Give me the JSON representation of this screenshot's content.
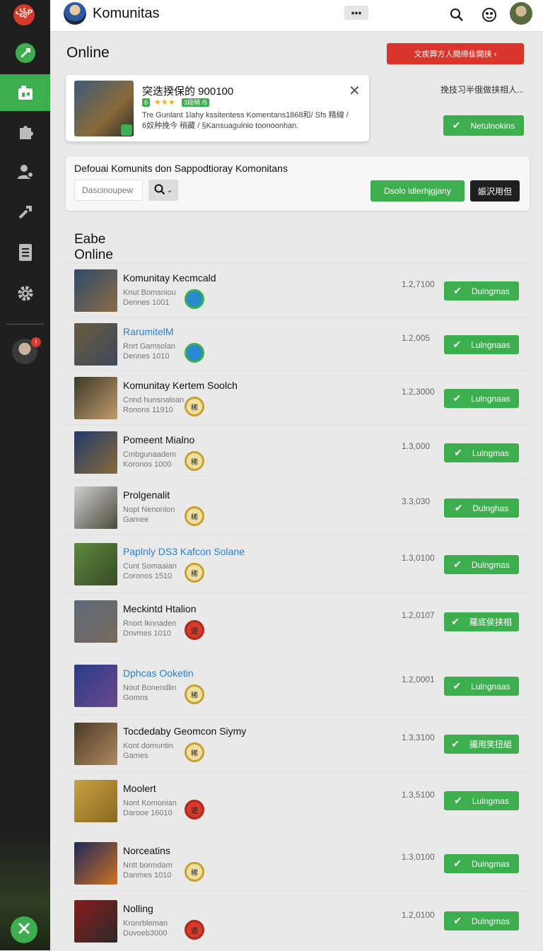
{
  "sidebar": {
    "logo_text": "꧁P",
    "items": [
      {
        "icon": "rocket-icon",
        "active": false
      },
      {
        "icon": "building-icon",
        "active": true
      },
      {
        "icon": "puzzle-icon",
        "active": false
      },
      {
        "icon": "user-settings-icon",
        "active": false
      },
      {
        "icon": "wrench-icon",
        "active": false
      },
      {
        "icon": "document-icon",
        "active": false
      },
      {
        "icon": "gear-icon",
        "active": false
      }
    ],
    "notif_count": "!"
  },
  "topbar": {
    "title": "Komunitas",
    "more_label": "•••"
  },
  "header": {
    "title": "Online",
    "red_button": "文疾葬方人閱缔隹開挟 ›"
  },
  "featured": {
    "title": "突迭揆保的 900100",
    "tag1": "6",
    "tag2": "3段稍 /5",
    "desc": "Tre Gunlant  1lahy kssitentess Komentans1868和/ Sfs 精線 / 6奴种挽今 稍藏 / §Kansuagulnio toonoonhan.",
    "side_text": "挽技习半俄做挟相人...",
    "notify_label": "Netulnokins"
  },
  "search": {
    "label": "Defouai Komunits don Sappodtioray Komonitans",
    "placeholder": "Dascinoupew",
    "discover_label": "Dsolo ldlerhjgjany",
    "dark_label": "娠沢用但"
  },
  "list": {
    "title": "Eabe Online",
    "groups": [
      [
        {
          "name": "Komunitay Kecmcald",
          "sub1": "Knut Bomsniou",
          "sub2": "Dennes 1001",
          "badge": "",
          "count": "1.2,7100",
          "btn": "Dulngmas"
        },
        {
          "name": "RarumitelM",
          "sub1": "Rnrt Gamsolan",
          "sub2": "Dennes 1010",
          "badge": "",
          "count": "1.2,005",
          "btn": "Lulngnaas"
        },
        {
          "name": "Komunitay Kertem Soolch",
          "sub1": "Cnnd hunsnaloan",
          "sub2": "Ronons 11910",
          "badge": "稀",
          "count": "1.2,3000",
          "btn": "Lulngnaas"
        },
        {
          "name": "Pomeent Mialno",
          "sub1": "Cmbgunaadem",
          "sub2": "Koronos 1000",
          "badge": "稀",
          "count": "1.3,000",
          "btn": "Lulngmas"
        },
        {
          "name": "Prolgenalit",
          "sub1": "Nopt Nenonlon",
          "sub2": "Gamee",
          "badge": "稀",
          "count": "3.3,030",
          "btn": "Dulnghas"
        },
        {
          "name": "Paplnly  DS3  Kafcon Solane",
          "sub1": "Cunt Somaaian",
          "sub2": "Coronos 1510",
          "badge": "稀",
          "count": "1.3,0100",
          "btn": "Dulngmas"
        },
        {
          "name": "Meckintd Htalion",
          "sub1": "Rnort Iknnaden",
          "sub2": "Dnvmes 1010",
          "badge": "遊",
          "count": "1.2,0107",
          "btn": "羅底侯挟相"
        }
      ],
      [
        {
          "name": "Dphcas Ooketin",
          "sub1": "Nout Bonendlin",
          "sub2": "Gomns",
          "badge": "稀",
          "count": "1.2,0001",
          "btn": "Lulngnaas"
        },
        {
          "name": "Tocdedaby Geomcon Siymy",
          "sub1": "Kont domuntin",
          "sub2": "Games",
          "badge": "稀",
          "count": "1.3,3100",
          "btn": "撮用笑扭組"
        },
        {
          "name": "Moolert",
          "sub1": "Nont Komonian",
          "sub2": "Darooe 16010",
          "badge": "遊",
          "count": "1.3,5100",
          "btn": "Lulngmas"
        }
      ],
      [
        {
          "name": "Norceatins",
          "sub1": "Nntt bormdam",
          "sub2": "Danmes 1010",
          "badge": "稀",
          "count": "1.3,0100",
          "btn": "Dulngmas"
        },
        {
          "name": "Nolling",
          "sub1": "Kronrbleman",
          "sub2": "Duvoeb3000",
          "badge": "遊",
          "count": "1.2,0100",
          "btn": "Dulngmas"
        }
      ]
    ]
  }
}
